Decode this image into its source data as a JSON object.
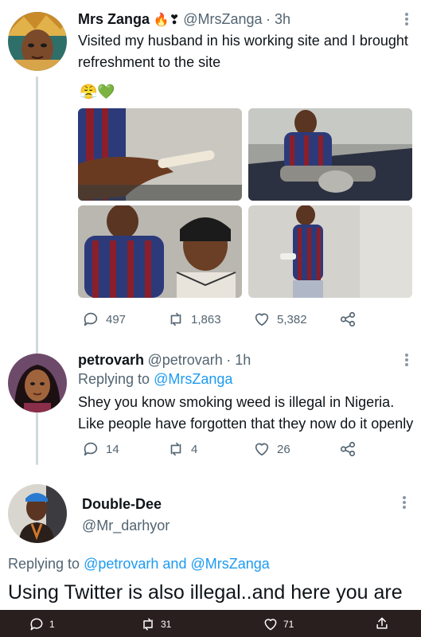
{
  "tweet1": {
    "name": "Mrs Zanga",
    "name_emoji": "🔥❣",
    "handle": "@MrsZanga",
    "time": "· 3h",
    "text": "Visited my husband in his working site and I brought refreshment to the site",
    "emoji_line": "😤💚",
    "replies": "497",
    "retweets": "1,863",
    "likes": "5,382"
  },
  "tweet2": {
    "name": "petrovarh",
    "handle": "@petrovarh",
    "time": "· 1h",
    "replying_prefix": "Replying to",
    "replying_to": "@MrsZanga",
    "text": "Shey you know smoking weed is illegal in Nigeria. Like people have forgotten that they now do it openly",
    "replies": "14",
    "retweets": "4",
    "likes": "26"
  },
  "tweet3": {
    "name": "Double-Dee",
    "handle": "@Mr_darhyor",
    "replying_prefix": "Replying to",
    "replying_to_1": "@petrovarh",
    "replying_and": "and",
    "replying_to_2": "@MrsZanga",
    "text": "Using Twitter is also illegal..and here you are",
    "replies": "1",
    "retweets": "31",
    "likes": "71"
  },
  "icons": {
    "reply": "reply-icon",
    "retweet": "retweet-icon",
    "like": "heart-icon",
    "share": "share-icon",
    "upload": "upload-icon",
    "more": "more-dots-icon"
  },
  "colors": {
    "link": "#1d9bf0",
    "muted": "#536471",
    "thread": "#cfd9de",
    "bottom_bar": "#2a1f1f"
  }
}
